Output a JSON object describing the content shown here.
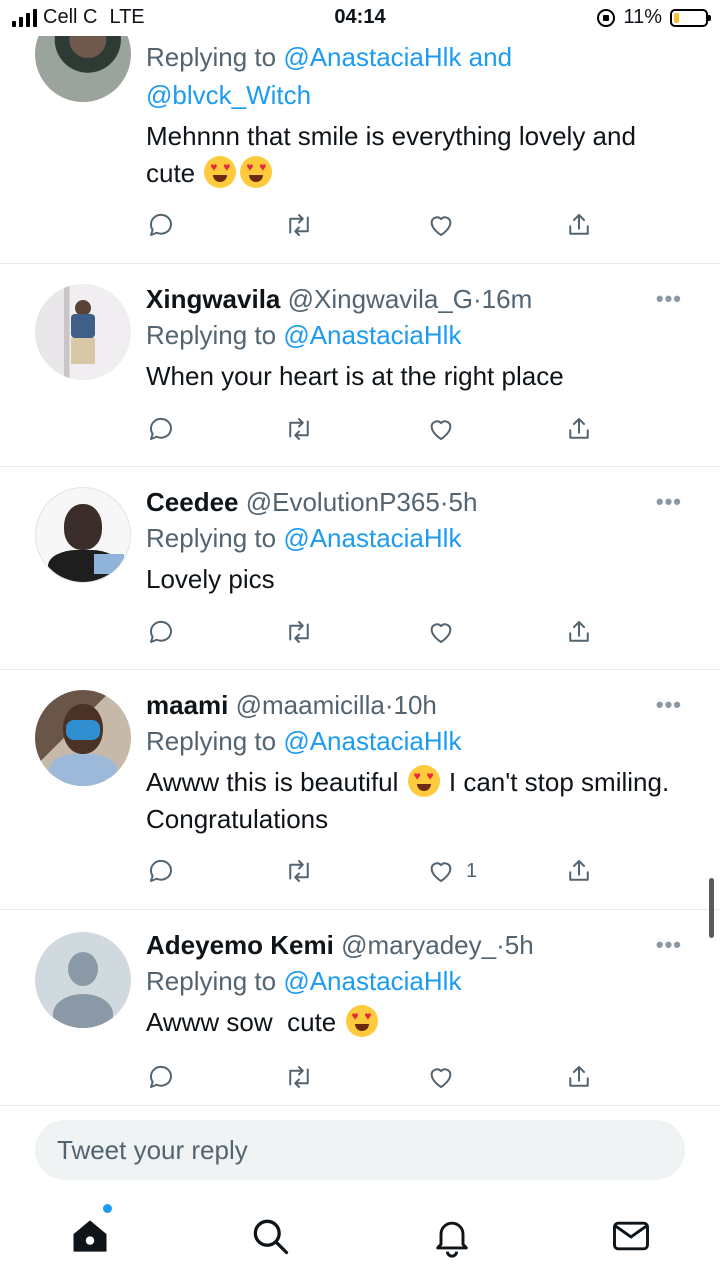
{
  "status_bar": {
    "carrier": "Cell C",
    "network": "LTE",
    "time": "04:14",
    "battery_pct": "11%",
    "battery_level": 0.11
  },
  "replies": [
    {
      "replying_prefix": "Replying to",
      "mentions": "@AnastaciaHlk and @blvck_Witch",
      "text_a": "Mehnnn that smile is everything lovely and cute",
      "emoji": [
        "heart-eyes-emoji",
        "heart-eyes-emoji"
      ],
      "likes": ""
    },
    {
      "name": "Xingwavila",
      "handle": "@Xingwavila_G",
      "time": "16m",
      "replying_prefix": "Replying to",
      "mentions": "@AnastaciaHlk",
      "text_a": "When your heart is at the right place",
      "likes": ""
    },
    {
      "name": "Ceedee",
      "handle": "@EvolutionP365",
      "time": "5h",
      "replying_prefix": "Replying to",
      "mentions": "@AnastaciaHlk",
      "text_a": "Lovely pics",
      "likes": ""
    },
    {
      "name": "maami",
      "handle": "@maamicilla",
      "time": "10h",
      "replying_prefix": "Replying to",
      "mentions": "@AnastaciaHlk",
      "text_a": "Awww this is beautiful",
      "text_b": "I can't stop smiling. Congratulations",
      "emoji": [
        "heart-eyes-emoji"
      ],
      "likes": "1"
    },
    {
      "name": "Adeyemo Kemi",
      "handle": "@maryadey_",
      "time": "5h",
      "replying_prefix": "Replying to",
      "mentions": "@AnastaciaHlk",
      "text_a": "Awww sow  cute",
      "emoji": [
        "smiling-face-with-hearts-emoji"
      ],
      "likes": ""
    }
  ],
  "separator_dot": "·",
  "more_glyph": "•••",
  "composer": {
    "placeholder": "Tweet your reply"
  },
  "colors": {
    "accent": "#1d9bf0",
    "muted": "#536471",
    "text": "#0f1419",
    "divider": "#e6ecf0"
  },
  "nav": {
    "icons": [
      "home-icon",
      "search-icon",
      "notifications-icon",
      "messages-icon"
    ]
  }
}
